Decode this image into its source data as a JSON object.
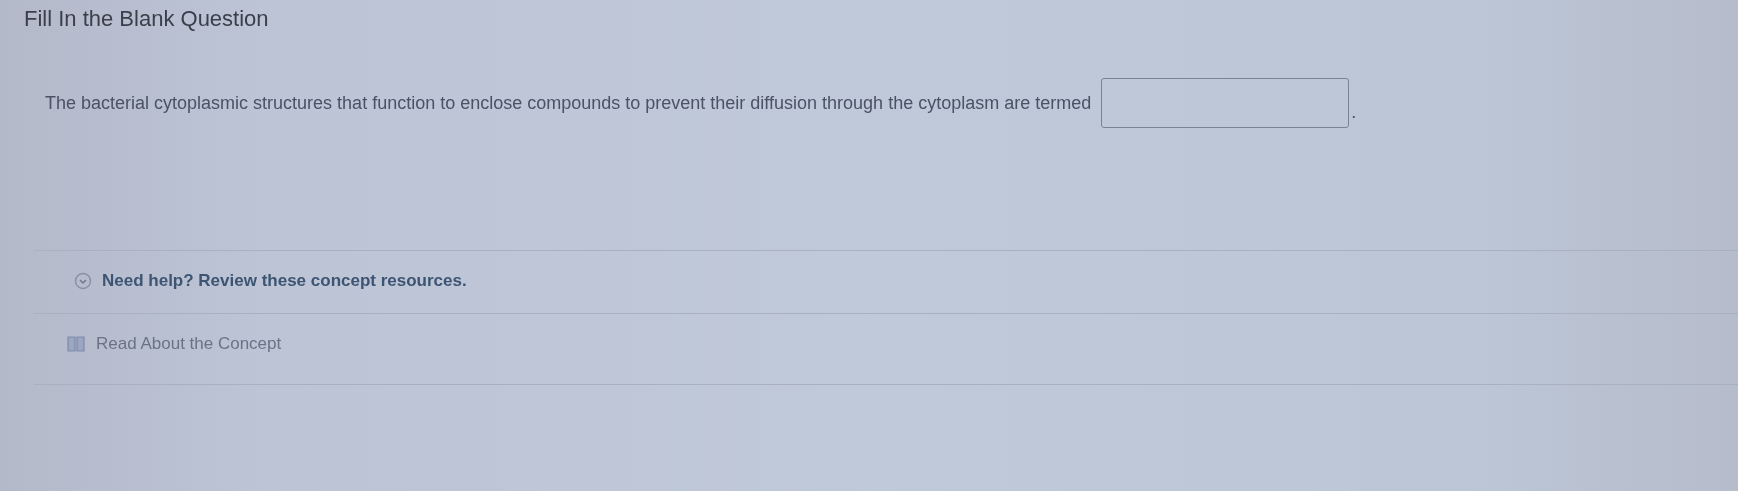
{
  "title": "Fill In the Blank Question",
  "question": {
    "before": "The bacterial cytoplasmic structures that function to enclose compounds to prevent their diffusion through the cytoplasm are termed",
    "after": "."
  },
  "help": {
    "label": "Need help? Review these concept resources.",
    "expanded": true,
    "resources": [
      {
        "label": "Read About the Concept"
      }
    ]
  }
}
